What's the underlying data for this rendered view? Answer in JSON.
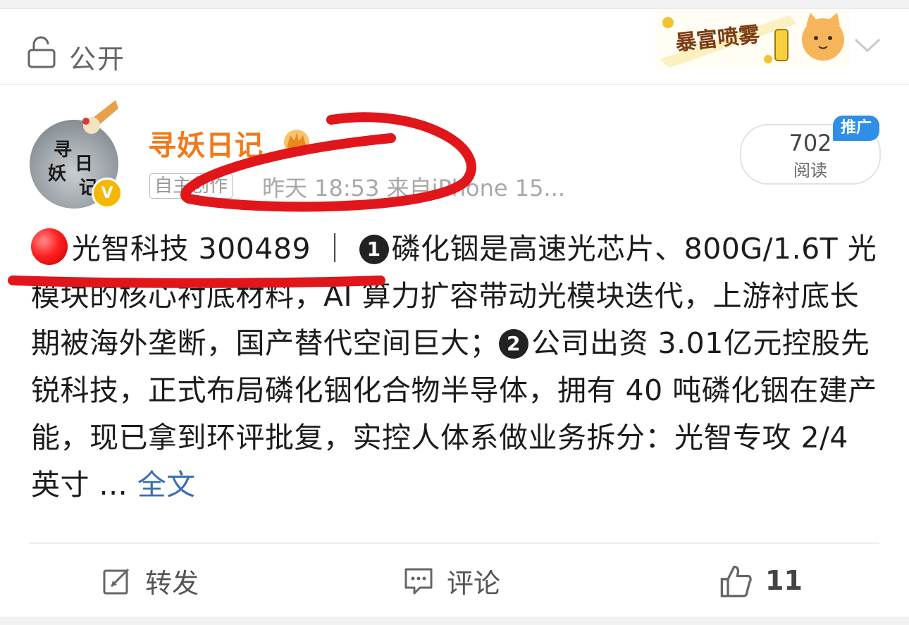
{
  "header": {
    "visibility_label": "公开",
    "sticker_text": "暴富喷雾"
  },
  "post": {
    "author": {
      "name": "寻妖日记",
      "avatar_chars": [
        "寻",
        "妖",
        "日",
        "记"
      ],
      "verified_mark": "V"
    },
    "tag": "自主创作",
    "meta": "昨天 18:53  来自iPhone 15...",
    "stats": {
      "read_count": "702",
      "read_label": "阅读",
      "promo_label": "推广"
    },
    "content": {
      "headline": "光智科技 300489",
      "separator": "｜",
      "point1_marker": "1",
      "point1_text": "磷化铟是高速光芯片、800G/1.6T 光模块的核心衬底材料，AI 算力扩容带动光模块迭代，上游衬底长期被海外垄断，国产替代空间巨大；",
      "point2_marker": "2",
      "point2_text": "公司出资 3.01亿元控股先锐科技，正式布局磷化铟化合物半导体，拥有 40 吨磷化铟在建产能，现已拿到环评批复，实控人体系做业务拆分：光智专攻 2/4 英寸 ...",
      "full_text_link": "全文"
    },
    "actions": {
      "repost_label": "转发",
      "comment_label": "评论",
      "like_count": "11"
    }
  },
  "colors": {
    "username": "#f07a1a",
    "link": "#3a6fb0",
    "promo": "#2f8fe8",
    "annotation": "#e0161b"
  }
}
